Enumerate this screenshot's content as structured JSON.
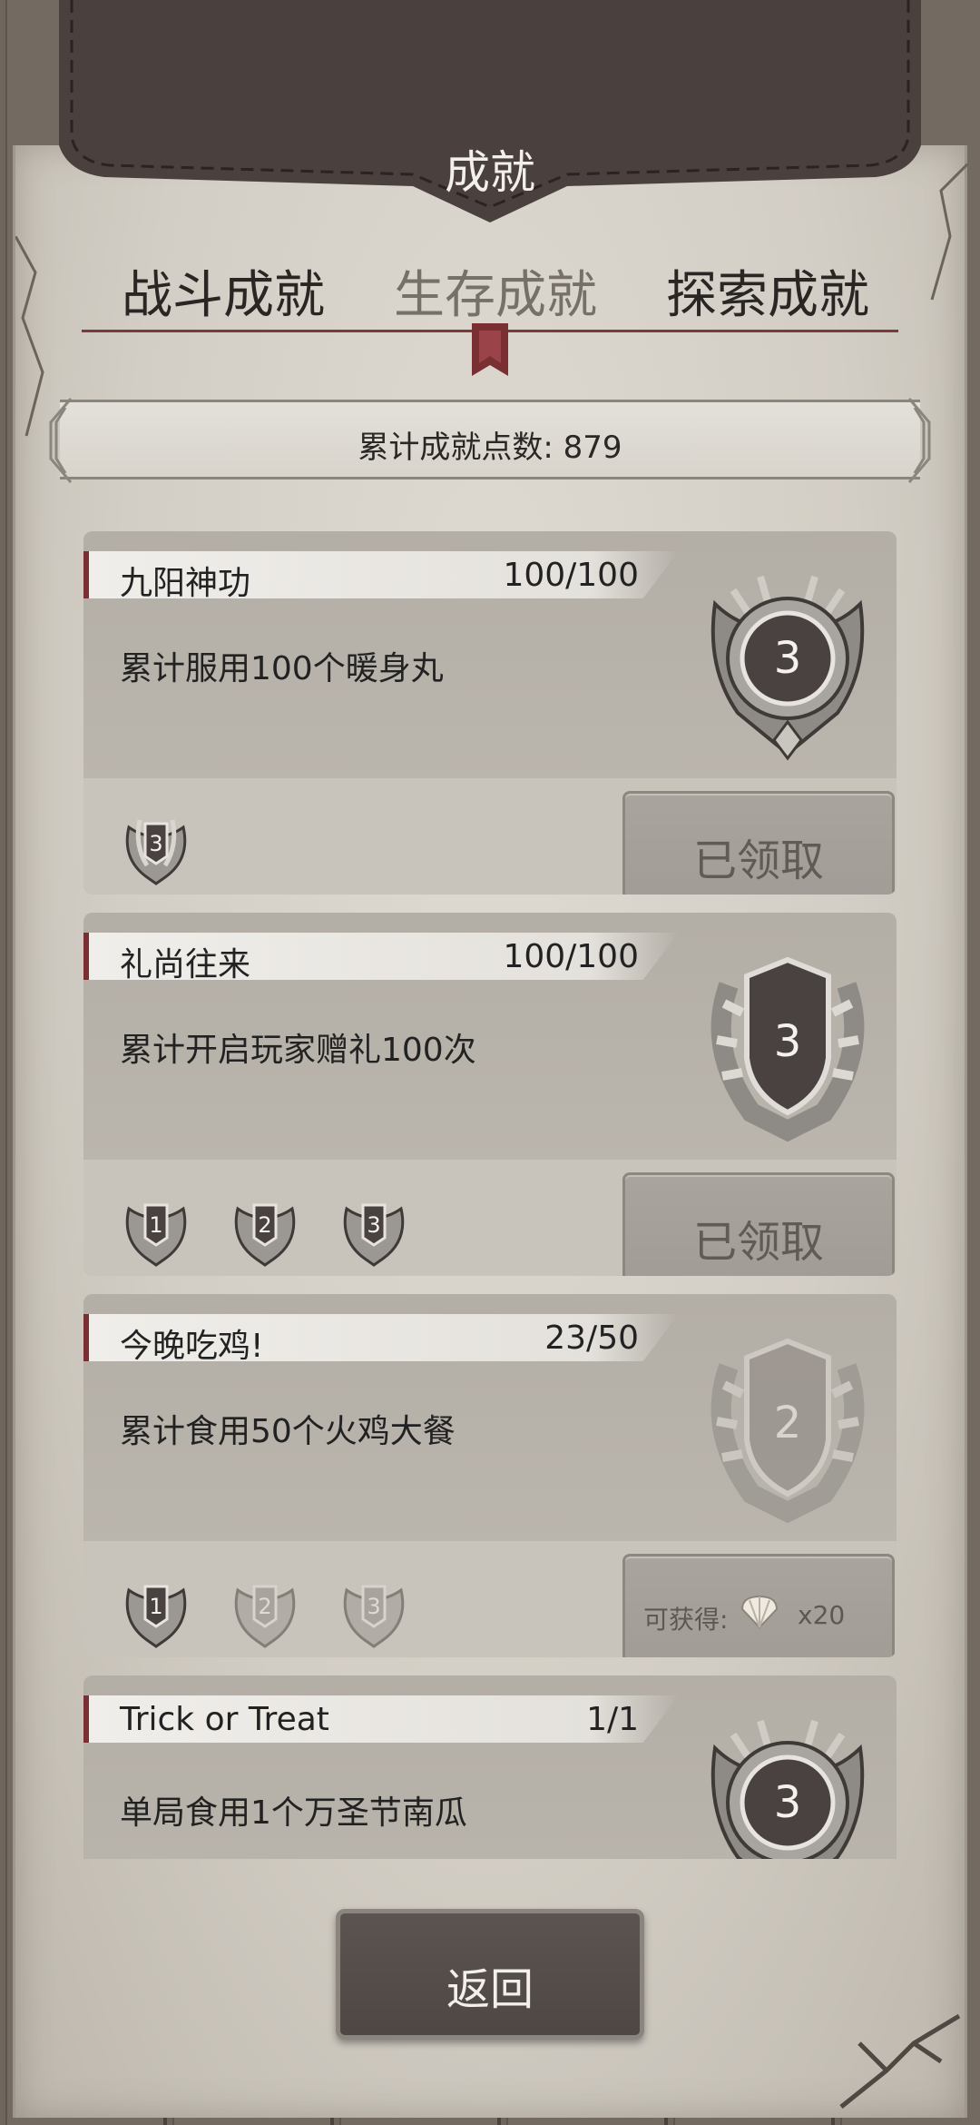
{
  "header": {
    "title": "成就"
  },
  "tabs": [
    {
      "label": "战斗成就",
      "active": false
    },
    {
      "label": "生存成就",
      "active": true
    },
    {
      "label": "探索成就",
      "active": false
    }
  ],
  "points": {
    "text": "累计成就点数: 879"
  },
  "achievements": [
    {
      "title": "九阳神功",
      "progress": "100/100",
      "description": "累计服用100个暖身丸",
      "badge_level": "3",
      "badge_style": "medal-gold-wreath",
      "mini_badges": [
        "3"
      ],
      "button": {
        "type": "claimed",
        "label": "已领取"
      }
    },
    {
      "title": "礼尚往来",
      "progress": "100/100",
      "description": "累计开启玩家赠礼100次",
      "badge_level": "3",
      "badge_style": "shield-laurel",
      "mini_badges": [
        "1",
        "2",
        "3"
      ],
      "button": {
        "type": "claimed",
        "label": "已领取"
      }
    },
    {
      "title": "今晚吃鸡!",
      "progress": "23/50",
      "description": "累计食用50个火鸡大餐",
      "badge_level": "2",
      "badge_style": "shield-laurel-faded",
      "mini_badges": [
        "1",
        "2",
        "3"
      ],
      "button": {
        "type": "reward",
        "reward_label": "可获得:",
        "reward_icon": "shell-icon",
        "reward_count": "x20"
      }
    },
    {
      "title": "Trick or Treat",
      "progress": "1/1",
      "description": "单局食用1个万圣节南瓜",
      "badge_level": "3",
      "badge_style": "medal-gold-wreath",
      "mini_badges": [],
      "button": null
    }
  ],
  "footer": {
    "back_label": "返回"
  },
  "colors": {
    "accent": "#7a2f33",
    "leather": "#4e4442",
    "parchment": "#d8d4cc"
  }
}
